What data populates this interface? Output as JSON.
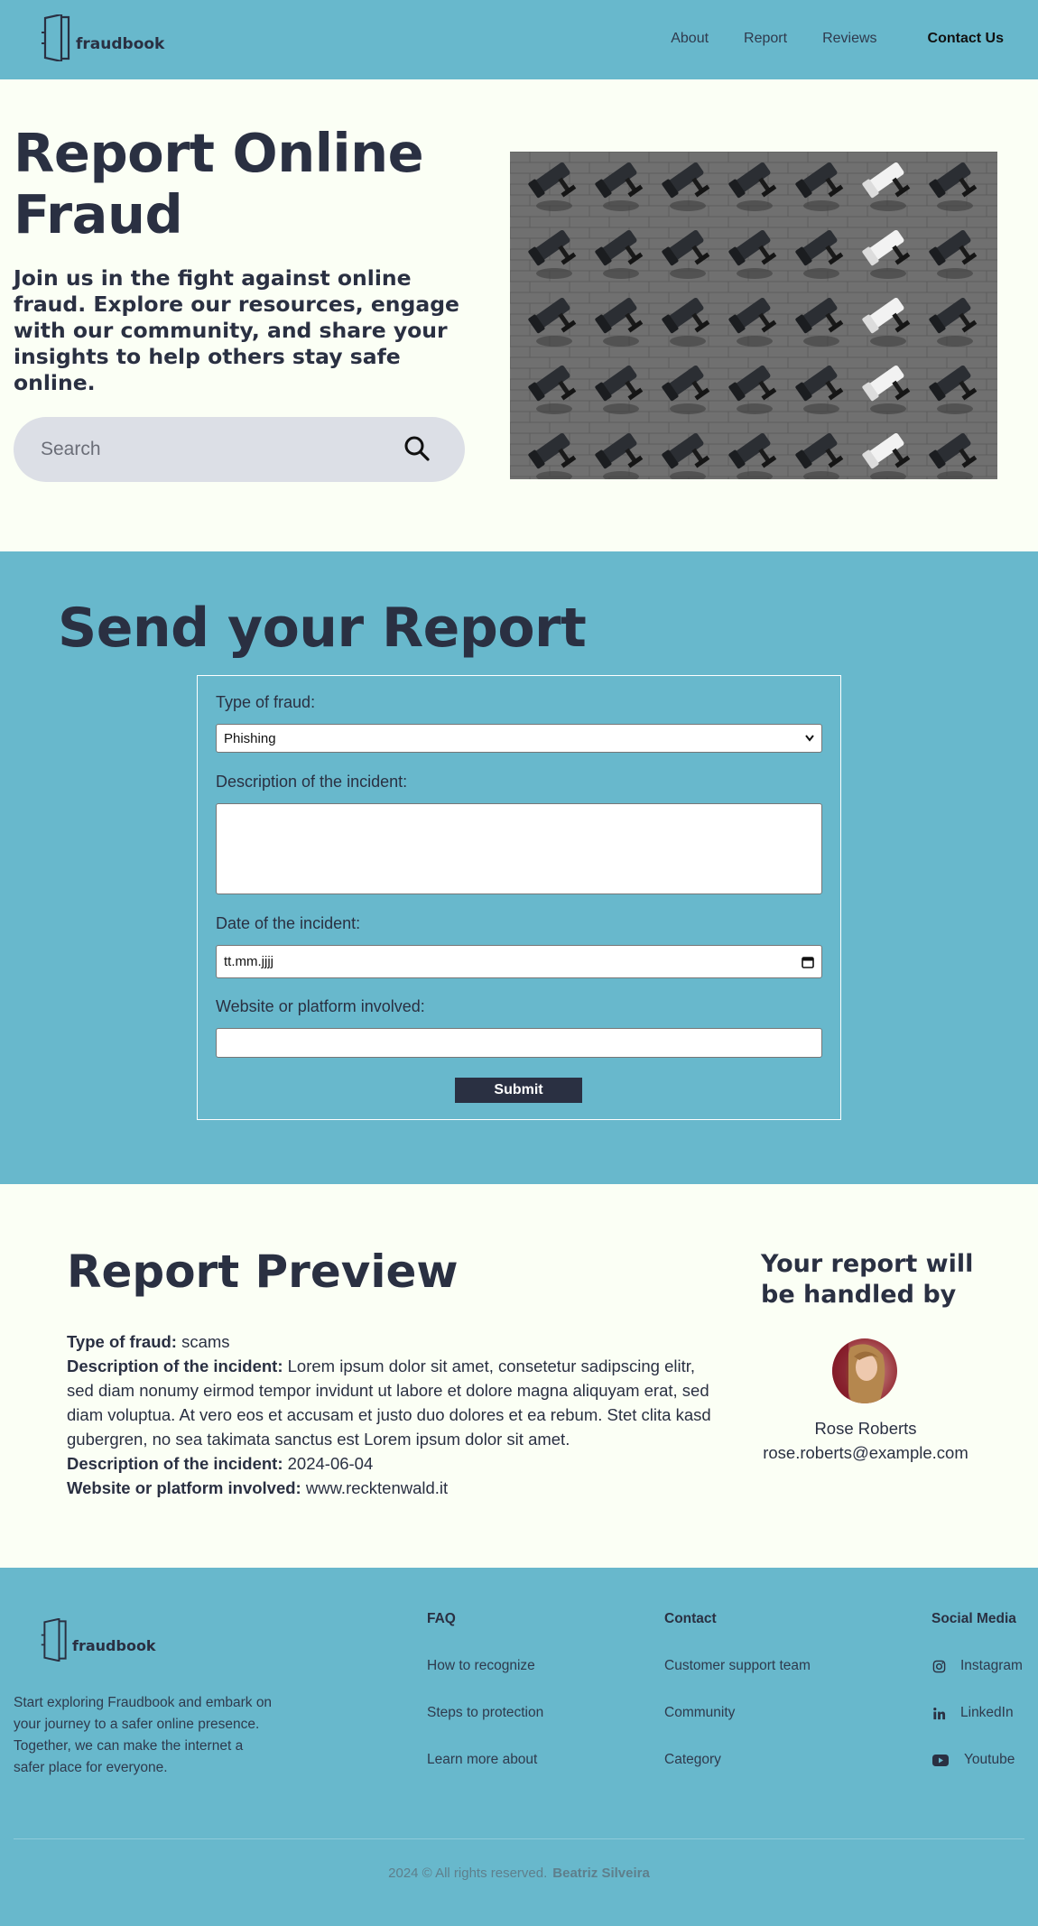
{
  "brand": {
    "name": "fraudbook"
  },
  "nav": {
    "items": [
      "About",
      "Report",
      "Reviews"
    ],
    "contact": "Contact Us"
  },
  "hero": {
    "title": "Report Online Fraud",
    "subtitle": "Join us in the fight against online fraud. Explore our resources, engage with our community, and share your insights to help others stay safe online.",
    "search_placeholder": "Search"
  },
  "report_form": {
    "heading": "Send your Report",
    "type_label": "Type of fraud:",
    "type_value": "Phishing",
    "description_label": "Description of the incident:",
    "date_label": "Date of the incident:",
    "date_placeholder": "tt.mm.jjjj",
    "website_label": "Website or platform involved:",
    "submit_label": "Submit"
  },
  "preview": {
    "heading": "Report Preview",
    "type_label": "Type of fraud:",
    "type_value": "scams",
    "description_label": "Description of the incident:",
    "description_value": "Lorem ipsum dolor sit amet, consetetur sadipscing elitr, sed diam nonumy eirmod tempor invidunt ut labore et dolore magna aliquyam erat, sed diam voluptua. At vero eos et accusam et justo duo dolores et ea rebum. Stet clita kasd gubergren, no sea takimata sanctus est Lorem ipsum dolor sit amet.",
    "date_label": "Description of the incident:",
    "date_value": "2024-06-04",
    "website_label": "Website or platform involved:",
    "website_value": "www.recktenwald.it"
  },
  "handler": {
    "heading": "Your report will be handled by",
    "name": "Rose Roberts",
    "email": "rose.roberts@example.com"
  },
  "footer": {
    "about": "Start exploring Fraudbook and embark on your journey to a safer online presence. Together, we can make the internet a safer place for everyone.",
    "faq": {
      "title": "FAQ",
      "links": [
        "How to recognize",
        "Steps to protection",
        "Learn more about"
      ]
    },
    "contact": {
      "title": "Contact",
      "links": [
        "Customer support team",
        "Community",
        "Category"
      ]
    },
    "social": {
      "title": "Social Media",
      "links": [
        "Instagram",
        "LinkedIn",
        "Youtube"
      ]
    },
    "copyright": "2024 © All rights reserved.",
    "author": "Beatriz Silveira"
  },
  "colors": {
    "teal": "#68b8cc",
    "navy": "#2a3042",
    "cream": "#fbfff5"
  }
}
